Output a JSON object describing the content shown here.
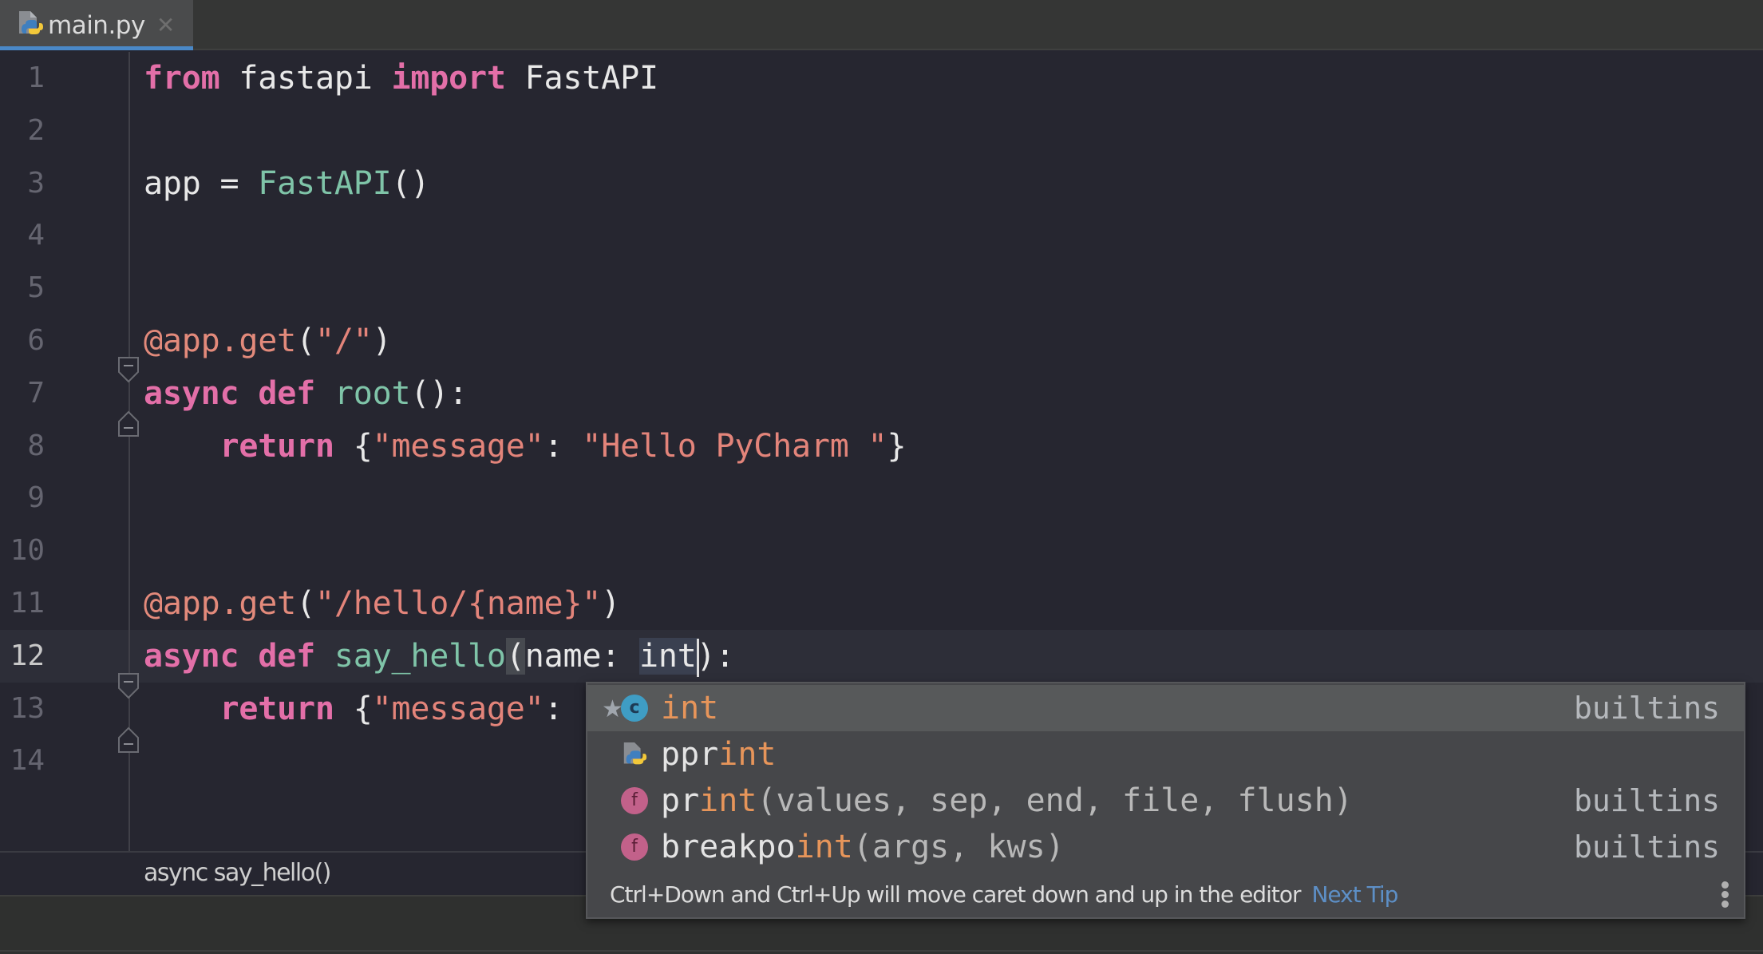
{
  "tab": {
    "label": "main.py",
    "icon": "python-file-icon",
    "close_icon": "close-icon",
    "accent": "#4a88c7"
  },
  "editor": {
    "current_line": 12,
    "line_numbers": [
      "1",
      "2",
      "3",
      "4",
      "5",
      "6",
      "7",
      "8",
      "9",
      "10",
      "11",
      "12",
      "13",
      "14"
    ],
    "lines": [
      {
        "n": 1,
        "tokens": [
          [
            "kw",
            "from"
          ],
          [
            "plain",
            " fastapi "
          ],
          [
            "kw",
            "import"
          ],
          [
            "plain",
            " FastAPI"
          ]
        ]
      },
      {
        "n": 2,
        "tokens": []
      },
      {
        "n": 3,
        "tokens": [
          [
            "plain",
            "app = "
          ],
          [
            "cls",
            "FastAPI"
          ],
          [
            "plain",
            "()"
          ]
        ]
      },
      {
        "n": 4,
        "tokens": []
      },
      {
        "n": 5,
        "tokens": []
      },
      {
        "n": 6,
        "tokens": [
          [
            "dec",
            "@app.get"
          ],
          [
            "plain",
            "("
          ],
          [
            "str",
            "\"/\""
          ],
          [
            "plain",
            ")"
          ]
        ]
      },
      {
        "n": 7,
        "tokens": [
          [
            "kw",
            "async"
          ],
          [
            "plain",
            " "
          ],
          [
            "kw",
            "def"
          ],
          [
            "plain",
            " "
          ],
          [
            "fn",
            "root"
          ],
          [
            "plain",
            "():"
          ]
        ]
      },
      {
        "n": 8,
        "tokens": [
          [
            "plain",
            "    "
          ],
          [
            "kw",
            "return"
          ],
          [
            "plain",
            " {"
          ],
          [
            "str",
            "\"message\""
          ],
          [
            "plain",
            ": "
          ],
          [
            "str",
            "\"Hello PyCharm \""
          ],
          [
            "plain",
            "}"
          ]
        ]
      },
      {
        "n": 9,
        "tokens": []
      },
      {
        "n": 10,
        "tokens": []
      },
      {
        "n": 11,
        "tokens": [
          [
            "dec",
            "@app.get"
          ],
          [
            "plain",
            "("
          ],
          [
            "str",
            "\"/hello/{name}\""
          ],
          [
            "plain",
            ")"
          ]
        ]
      },
      {
        "n": 12,
        "tokens": [
          [
            "kw",
            "async"
          ],
          [
            "plain",
            " "
          ],
          [
            "kw",
            "def"
          ],
          [
            "plain",
            " "
          ],
          [
            "fn",
            "say_hello"
          ],
          [
            "paren",
            "("
          ],
          [
            "plain",
            "name: "
          ],
          [
            "word",
            "int"
          ],
          [
            "caret",
            ""
          ],
          [
            "plain",
            ")"
          ],
          [
            "plain",
            ":"
          ]
        ]
      },
      {
        "n": 13,
        "tokens": [
          [
            "plain",
            "    "
          ],
          [
            "kw",
            "return"
          ],
          [
            "plain",
            " {"
          ],
          [
            "str",
            "\"message\""
          ],
          [
            "plain",
            ":"
          ]
        ]
      },
      {
        "n": 14,
        "tokens": []
      }
    ]
  },
  "breadcrumb": {
    "label": "async say_hello()"
  },
  "completion": {
    "items": [
      {
        "starred": true,
        "icon": "class-icon",
        "icon_letter": "c",
        "prefix": "",
        "match": "int",
        "suffix": "",
        "signature": "",
        "source": "builtins",
        "selected": true
      },
      {
        "starred": false,
        "icon": "python-module-icon",
        "icon_letter": "",
        "prefix": "ppr",
        "match": "int",
        "suffix": "",
        "signature": "",
        "source": "",
        "selected": false
      },
      {
        "starred": false,
        "icon": "function-icon",
        "icon_letter": "f",
        "prefix": "pr",
        "match": "int",
        "suffix": "",
        "signature": "(values, sep, end, file, flush)",
        "source": "builtins",
        "selected": false
      },
      {
        "starred": false,
        "icon": "function-icon",
        "icon_letter": "f",
        "prefix": "breakpo",
        "match": "int",
        "suffix": "",
        "signature": "(args, kws)",
        "source": "builtins",
        "selected": false
      }
    ],
    "tip": {
      "text": "Ctrl+Down and Ctrl+Up will move caret down and up in the editor",
      "link": "Next Tip",
      "menu_icon": "more-vertical-icon"
    }
  },
  "colors": {
    "keyword": "#e36fa8",
    "function": "#7fc4a8",
    "string": "#e3847a",
    "match": "#e7955a",
    "link": "#5d8fc6",
    "editor_bg": "#262630"
  }
}
